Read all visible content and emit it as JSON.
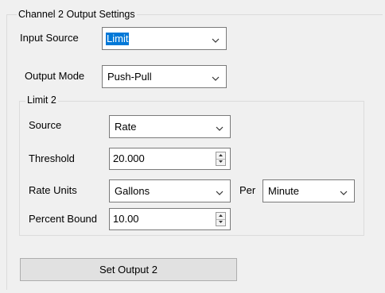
{
  "output_group": {
    "title": "Channel 2 Output Settings",
    "input_source_label": "Input Source",
    "input_source_value": "Limit",
    "output_mode_label": "Output Mode",
    "output_mode_value": "Push-Pull"
  },
  "limit_group": {
    "title": "Limit 2",
    "source_label": "Source",
    "source_value": "Rate",
    "threshold_label": "Threshold",
    "threshold_value": "20.000",
    "rate_units_label": "Rate Units",
    "rate_units_value": "Gallons",
    "per_label": "Per",
    "per_value": "Minute",
    "percent_bound_label": "Percent Bound",
    "percent_bound_value": "10.00"
  },
  "set_output_button": "Set Output 2",
  "icons": {
    "dropdown": "chevron-down-icon",
    "spin_up": "spin-up-icon",
    "spin_down": "spin-down-icon"
  }
}
